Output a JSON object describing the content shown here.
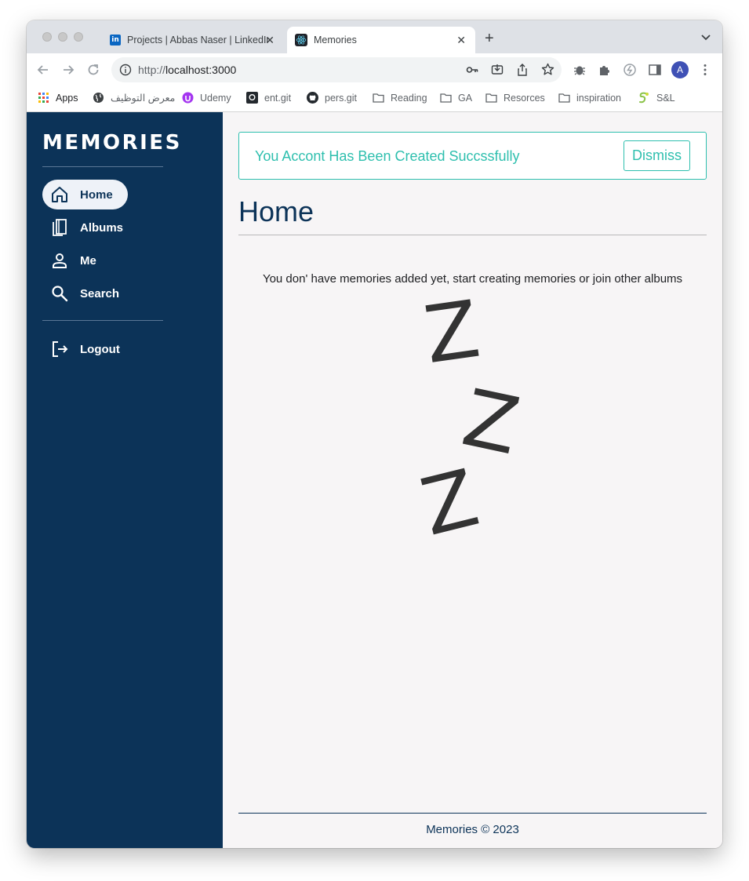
{
  "browser": {
    "tabs": [
      {
        "title": "Projects | Abbas Naser | LinkedIn",
        "favicon": "linkedin-icon",
        "active": false
      },
      {
        "title": "Memories",
        "favicon": "react-icon",
        "active": true
      }
    ],
    "url_scheme": "http://",
    "url_host": "localhost:3000",
    "bookmarks": [
      {
        "label": "Apps",
        "icon": "apps-grid-icon"
      },
      {
        "label": "معرض التوظيف",
        "icon": "globe-icon"
      },
      {
        "label": "Udemy",
        "icon": "udemy-icon"
      },
      {
        "label": "ent.git",
        "icon": "github-icon"
      },
      {
        "label": "pers.git",
        "icon": "github-icon"
      },
      {
        "label": "Reading",
        "icon": "folder-icon"
      },
      {
        "label": "GA",
        "icon": "folder-icon"
      },
      {
        "label": "Resorces",
        "icon": "folder-icon"
      },
      {
        "label": "inspiration",
        "icon": "folder-icon"
      },
      {
        "label": "S&L",
        "icon": "snake-icon"
      }
    ],
    "profile_initial": "A"
  },
  "sidebar": {
    "brand": "MEMORIES",
    "items": [
      {
        "label": "Home",
        "icon": "home-icon",
        "active": true
      },
      {
        "label": "Albums",
        "icon": "albums-icon",
        "active": false
      },
      {
        "label": "Me",
        "icon": "person-icon",
        "active": false
      },
      {
        "label": "Search",
        "icon": "search-icon",
        "active": false
      }
    ],
    "logout_label": "Logout"
  },
  "main": {
    "alert_message": "You Accont Has Been Created Succssfully",
    "dismiss_label": "Dismiss",
    "page_title": "Home",
    "empty_message": "You don' have memories added yet, start creating memories or join other albums",
    "zzz_letters": [
      "Z",
      "Z",
      "Z"
    ],
    "footer": "Memories © 2023"
  },
  "colors": {
    "sidebar_bg": "#0c3358",
    "accent": "#2ebfae",
    "page_bg": "#f7f5f6"
  }
}
